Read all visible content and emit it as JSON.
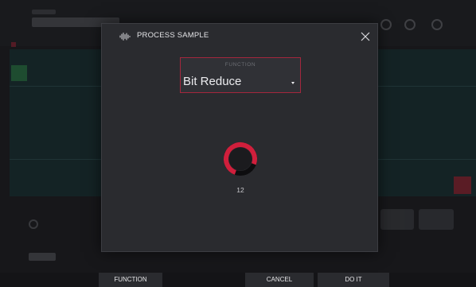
{
  "dialog": {
    "title": "PROCESS SAMPLE",
    "icon": "waveform-icon",
    "close_icon": "close-icon",
    "function_caption": "FUNCTION",
    "function_value": "Bit Reduce",
    "knob_value": "12",
    "knob_level_fraction": 0.75
  },
  "bottom_bar": {
    "function_label": "FUNCTION",
    "cancel_label": "CANCEL",
    "do_it_label": "DO IT"
  },
  "colors": {
    "accent": "#d01f3c",
    "select_border": "#a4273d",
    "modal_bg": "#2a2b2f",
    "screen_bg": "#17171a"
  }
}
